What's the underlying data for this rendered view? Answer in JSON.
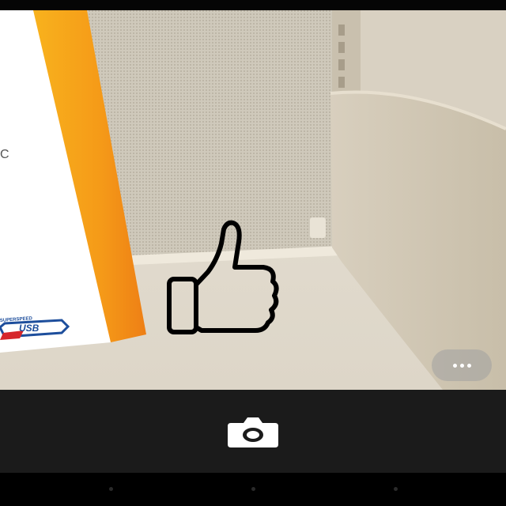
{
  "viewfinder": {
    "scene_text": {
      "letter_c": "C",
      "speed_text": "SUPERSPEED",
      "usb_text": "USB"
    },
    "overlay_icon": "thumbs-up-icon"
  },
  "more_options": {
    "icon": "more-horizontal-icon"
  },
  "controls": {
    "shutter_icon": "camera-icon"
  },
  "navigation": {
    "back_icon": "nav-back-icon",
    "home_icon": "nav-home-icon",
    "recents_icon": "nav-recents-icon"
  },
  "colors": {
    "control_bar": "#1b1b1b",
    "package_orange": "#f49a1c",
    "usb_blue": "#1d4e9c",
    "usb_red": "#d6262b"
  }
}
